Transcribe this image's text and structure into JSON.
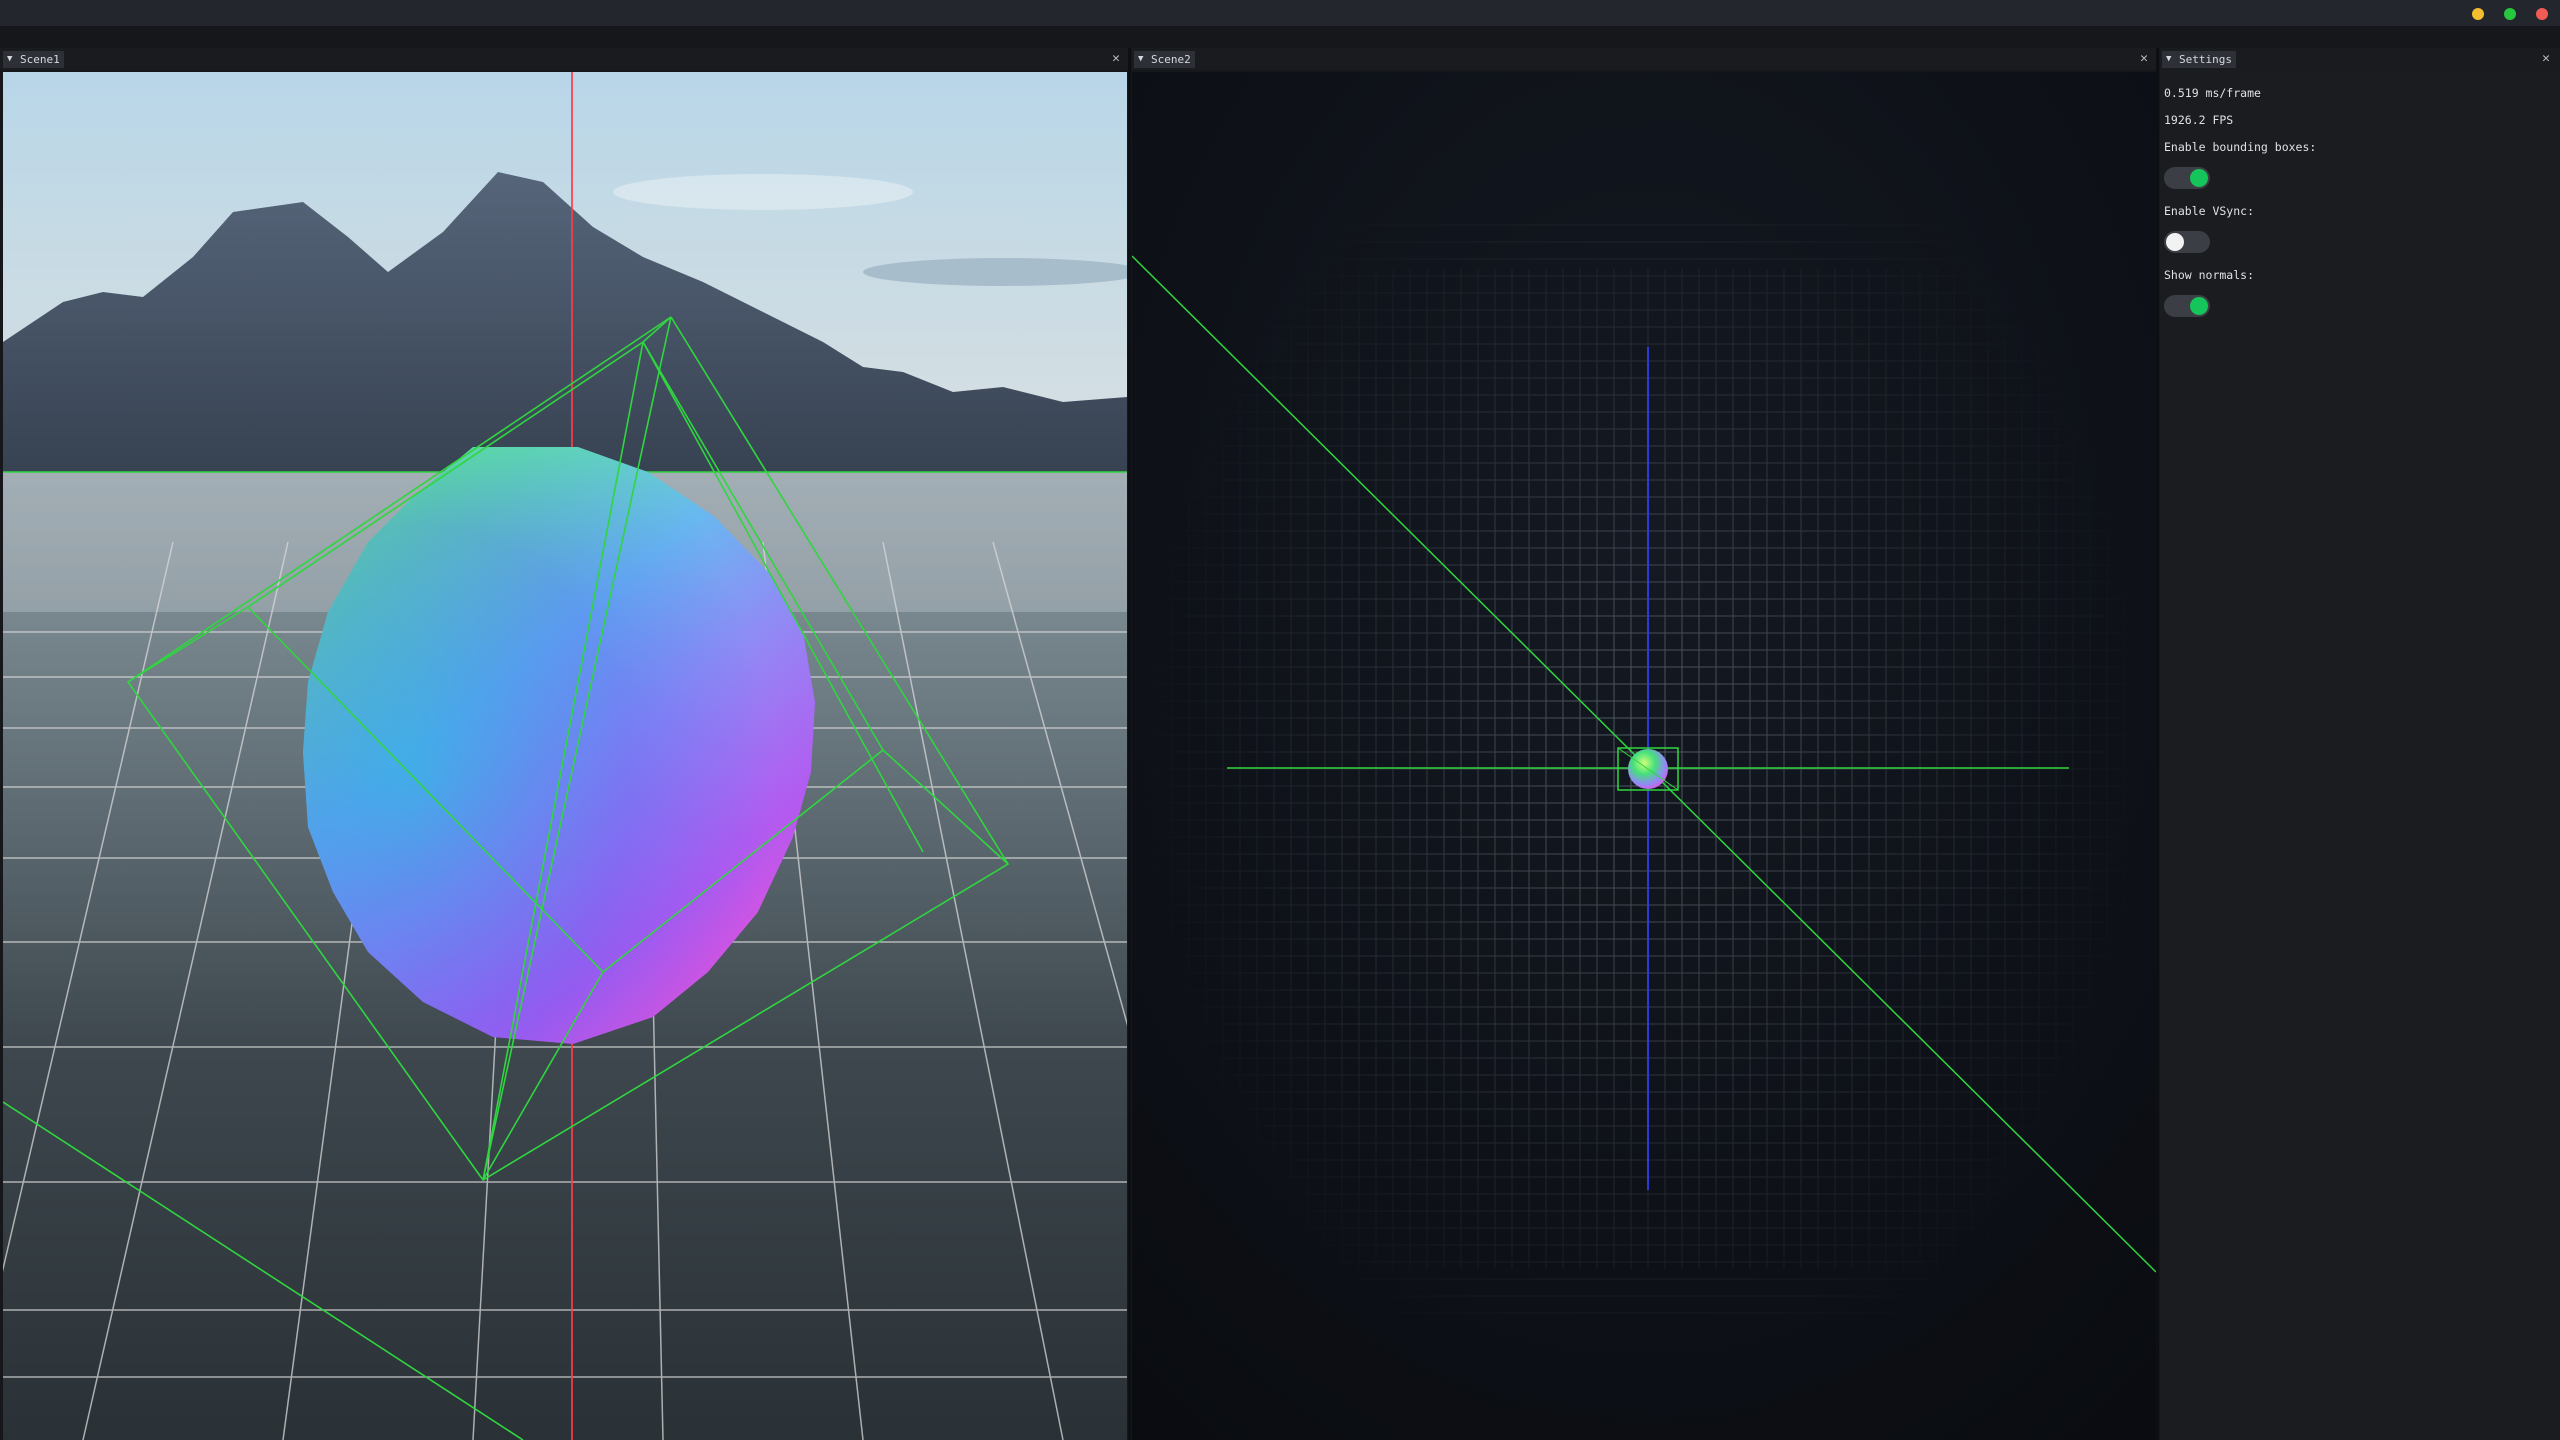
{
  "window": {
    "controls": [
      {
        "name": "minimize",
        "color": "#f6bd2f"
      },
      {
        "name": "maximize",
        "color": "#27c840"
      },
      {
        "name": "close",
        "color": "#f15a55"
      }
    ]
  },
  "panels": {
    "scene1": {
      "tab_label": "Scene1",
      "collapse_icon": "triangle-down-icon",
      "close_icon": "close-icon"
    },
    "scene2": {
      "tab_label": "Scene2",
      "collapse_icon": "triangle-down-icon",
      "close_icon": "close-icon"
    },
    "settings": {
      "tab_label": "Settings",
      "collapse_icon": "triangle-down-icon",
      "close_icon": "close-icon"
    }
  },
  "settings": {
    "frame_time": "0.519 ms/frame",
    "fps": "1926.2 FPS",
    "options": [
      {
        "label": "Enable bounding boxes:",
        "enabled": true
      },
      {
        "label": "Enable VSync:",
        "enabled": false
      },
      {
        "label": "Show normals:",
        "enabled": true
      }
    ]
  },
  "colors": {
    "toggle_on": "#15c45a",
    "toggle_off_knob": "#f2f2f2",
    "bounding_box": "#2fd63f",
    "axis_red": "#ff3b4a",
    "axis_blue": "#2d3bd6"
  }
}
